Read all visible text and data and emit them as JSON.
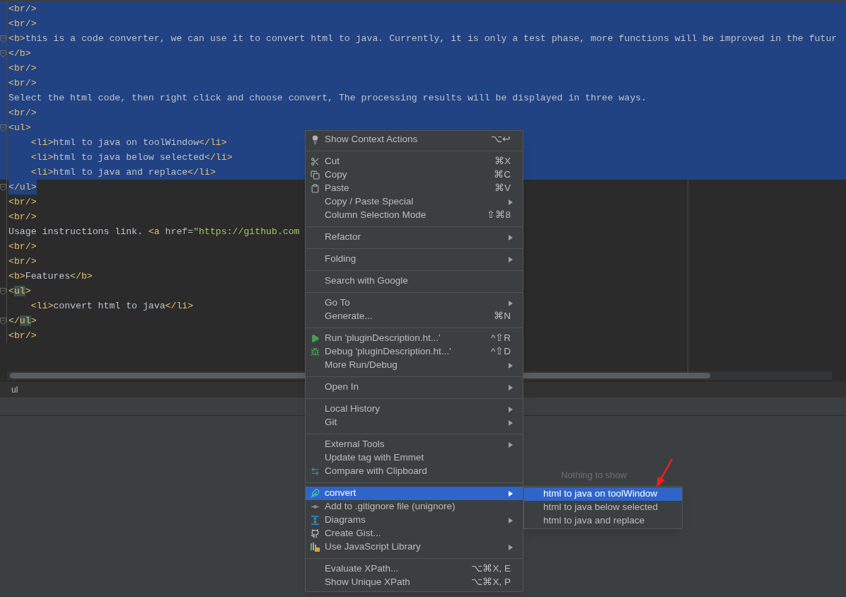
{
  "editor": {
    "lines": [
      {
        "selected": true,
        "text_selected": false,
        "fold": false,
        "segments": [
          {
            "kind": "tag",
            "text": "<br/>"
          }
        ]
      },
      {
        "selected": true,
        "text_selected": false,
        "fold": false,
        "segments": [
          {
            "kind": "tag",
            "text": "<br/>"
          }
        ]
      },
      {
        "selected": true,
        "text_selected": false,
        "fold": true,
        "segments": [
          {
            "kind": "tag",
            "text": "<b>"
          },
          {
            "kind": "text",
            "text": "this is a code converter, we can use it to convert html to java. Currently, it is only a test phase, more functions will be improved in the futur"
          }
        ]
      },
      {
        "selected": true,
        "text_selected": false,
        "fold": true,
        "segments": [
          {
            "kind": "tag",
            "text": "</b>"
          }
        ]
      },
      {
        "selected": true,
        "text_selected": false,
        "fold": false,
        "segments": [
          {
            "kind": "tag",
            "text": "<br/>"
          }
        ]
      },
      {
        "selected": true,
        "text_selected": false,
        "fold": false,
        "segments": [
          {
            "kind": "tag",
            "text": "<br/>"
          }
        ]
      },
      {
        "selected": true,
        "text_selected": false,
        "fold": false,
        "segments": [
          {
            "kind": "text",
            "text": "Select the html code, then right click and choose convert, The processing results will be displayed in three ways."
          }
        ]
      },
      {
        "selected": true,
        "text_selected": false,
        "fold": false,
        "segments": [
          {
            "kind": "tag",
            "text": "<br/>"
          }
        ]
      },
      {
        "selected": true,
        "text_selected": false,
        "fold": true,
        "segments": [
          {
            "kind": "tag",
            "text": "<ul>"
          }
        ]
      },
      {
        "selected": true,
        "text_selected": false,
        "fold": false,
        "segments": [
          {
            "kind": "tag",
            "text": "    <li>"
          },
          {
            "kind": "text",
            "text": "html to java on toolWindow"
          },
          {
            "kind": "tag",
            "text": "</li>"
          }
        ]
      },
      {
        "selected": true,
        "text_selected": false,
        "fold": false,
        "segments": [
          {
            "kind": "tag",
            "text": "    <li>"
          },
          {
            "kind": "text",
            "text": "html to java below selected"
          },
          {
            "kind": "tag",
            "text": "</li>"
          }
        ]
      },
      {
        "selected": true,
        "text_selected": false,
        "fold": false,
        "segments": [
          {
            "kind": "tag",
            "text": "    <li>"
          },
          {
            "kind": "text",
            "text": "html to java and replace"
          },
          {
            "kind": "tag",
            "text": "</li>"
          }
        ]
      },
      {
        "selected": false,
        "text_selected": true,
        "fold": true,
        "segments": [
          {
            "kind": "tag",
            "text": "</ul>"
          }
        ]
      },
      {
        "selected": false,
        "text_selected": false,
        "fold": false,
        "segments": [
          {
            "kind": "tag",
            "text": "<br/>"
          }
        ]
      },
      {
        "selected": false,
        "text_selected": false,
        "fold": false,
        "segments": [
          {
            "kind": "tag",
            "text": "<br/>"
          }
        ]
      },
      {
        "selected": false,
        "text_selected": false,
        "fold": false,
        "segments": [
          {
            "kind": "text",
            "text": "Usage instructions link. "
          },
          {
            "kind": "tag",
            "text": "<a"
          },
          {
            "kind": "attr",
            "text": " href="
          },
          {
            "kind": "string",
            "text": "\"https://github.com"
          }
        ]
      },
      {
        "selected": false,
        "text_selected": false,
        "fold": false,
        "segments": [
          {
            "kind": "tag",
            "text": "<br/>"
          }
        ]
      },
      {
        "selected": false,
        "text_selected": false,
        "fold": false,
        "segments": [
          {
            "kind": "tag",
            "text": "<br/>"
          }
        ]
      },
      {
        "selected": false,
        "text_selected": false,
        "fold": false,
        "segments": [
          {
            "kind": "tag",
            "text": "<b>"
          },
          {
            "kind": "text",
            "text": "Features"
          },
          {
            "kind": "tag",
            "text": "</b>"
          }
        ]
      },
      {
        "selected": false,
        "text_selected": false,
        "fold": true,
        "segments": [
          {
            "kind": "tag",
            "text": "<"
          },
          {
            "kind": "match",
            "text": "ul"
          },
          {
            "kind": "tag",
            "text": ">"
          }
        ]
      },
      {
        "selected": false,
        "text_selected": false,
        "fold": false,
        "segments": [
          {
            "kind": "tag",
            "text": "    <li>"
          },
          {
            "kind": "text",
            "text": "convert html to java"
          },
          {
            "kind": "tag",
            "text": "</li>"
          }
        ]
      },
      {
        "selected": false,
        "text_selected": false,
        "fold": true,
        "segments": [
          {
            "kind": "tag",
            "text": "</"
          },
          {
            "kind": "match",
            "text": "ul"
          },
          {
            "kind": "tag",
            "text": ">"
          }
        ]
      },
      {
        "selected": false,
        "text_selected": false,
        "fold": false,
        "segments": [
          {
            "kind": "tag",
            "text": "<br/>"
          }
        ]
      }
    ]
  },
  "breadcrumb": "ul",
  "tool_window": {
    "empty_text": "Nothing to show"
  },
  "context_menu": {
    "groups": [
      [
        {
          "label": "Show Context Actions",
          "shortcut": "⌥↩",
          "submenu": false,
          "selected": false
        }
      ],
      [
        {
          "label": "Cut",
          "shortcut": "⌘X",
          "submenu": false,
          "selected": false
        },
        {
          "label": "Copy",
          "shortcut": "⌘C",
          "submenu": false,
          "selected": false
        },
        {
          "label": "Paste",
          "shortcut": "⌘V",
          "submenu": false,
          "selected": false
        },
        {
          "label": "Copy / Paste Special",
          "submenu": true,
          "selected": false
        },
        {
          "label": "Column Selection Mode",
          "shortcut": "⇧⌘8",
          "submenu": false,
          "selected": false
        }
      ],
      [
        {
          "label": "Refactor",
          "submenu": true,
          "selected": false
        }
      ],
      [
        {
          "label": "Folding",
          "submenu": true,
          "selected": false
        }
      ],
      [
        {
          "label": "Search with Google",
          "submenu": false,
          "selected": false
        }
      ],
      [
        {
          "label": "Go To",
          "submenu": true,
          "selected": false
        },
        {
          "label": "Generate...",
          "shortcut": "⌘N",
          "submenu": false,
          "selected": false
        }
      ],
      [
        {
          "label": "Run 'pluginDescription.ht...'",
          "shortcut": "^⇧R",
          "submenu": false,
          "selected": false
        },
        {
          "label": "Debug 'pluginDescription.ht...'",
          "shortcut": "^⇧D",
          "submenu": false,
          "selected": false
        },
        {
          "label": "More Run/Debug",
          "submenu": true,
          "selected": false
        }
      ],
      [
        {
          "label": "Open In",
          "submenu": true,
          "selected": false
        }
      ],
      [
        {
          "label": "Local History",
          "submenu": true,
          "selected": false
        },
        {
          "label": "Git",
          "submenu": true,
          "selected": false
        }
      ],
      [
        {
          "label": "External Tools",
          "submenu": true,
          "selected": false
        },
        {
          "label": "Update tag with Emmet",
          "submenu": false,
          "selected": false
        },
        {
          "label": "Compare with Clipboard",
          "submenu": false,
          "selected": false
        }
      ],
      [
        {
          "label": "convert",
          "submenu": true,
          "selected": true
        },
        {
          "label": "Add to .gitignore file (unignore)",
          "submenu": false,
          "selected": false
        },
        {
          "label": "Diagrams",
          "submenu": true,
          "selected": false
        },
        {
          "label": "Create Gist...",
          "submenu": false,
          "selected": false
        },
        {
          "label": "Use JavaScript Library",
          "submenu": true,
          "selected": false
        }
      ],
      [
        {
          "label": "Evaluate XPath...",
          "shortcut": "⌥⌘X, E",
          "submenu": false,
          "selected": false
        },
        {
          "label": "Show Unique XPath",
          "shortcut": "⌥⌘X, P",
          "submenu": false,
          "selected": false
        }
      ]
    ]
  },
  "submenu": {
    "items": [
      {
        "label": "html to java on toolWindow",
        "selected": true
      },
      {
        "label": "html to java below selected",
        "selected": false
      },
      {
        "label": "html to java and replace",
        "selected": false
      }
    ]
  }
}
